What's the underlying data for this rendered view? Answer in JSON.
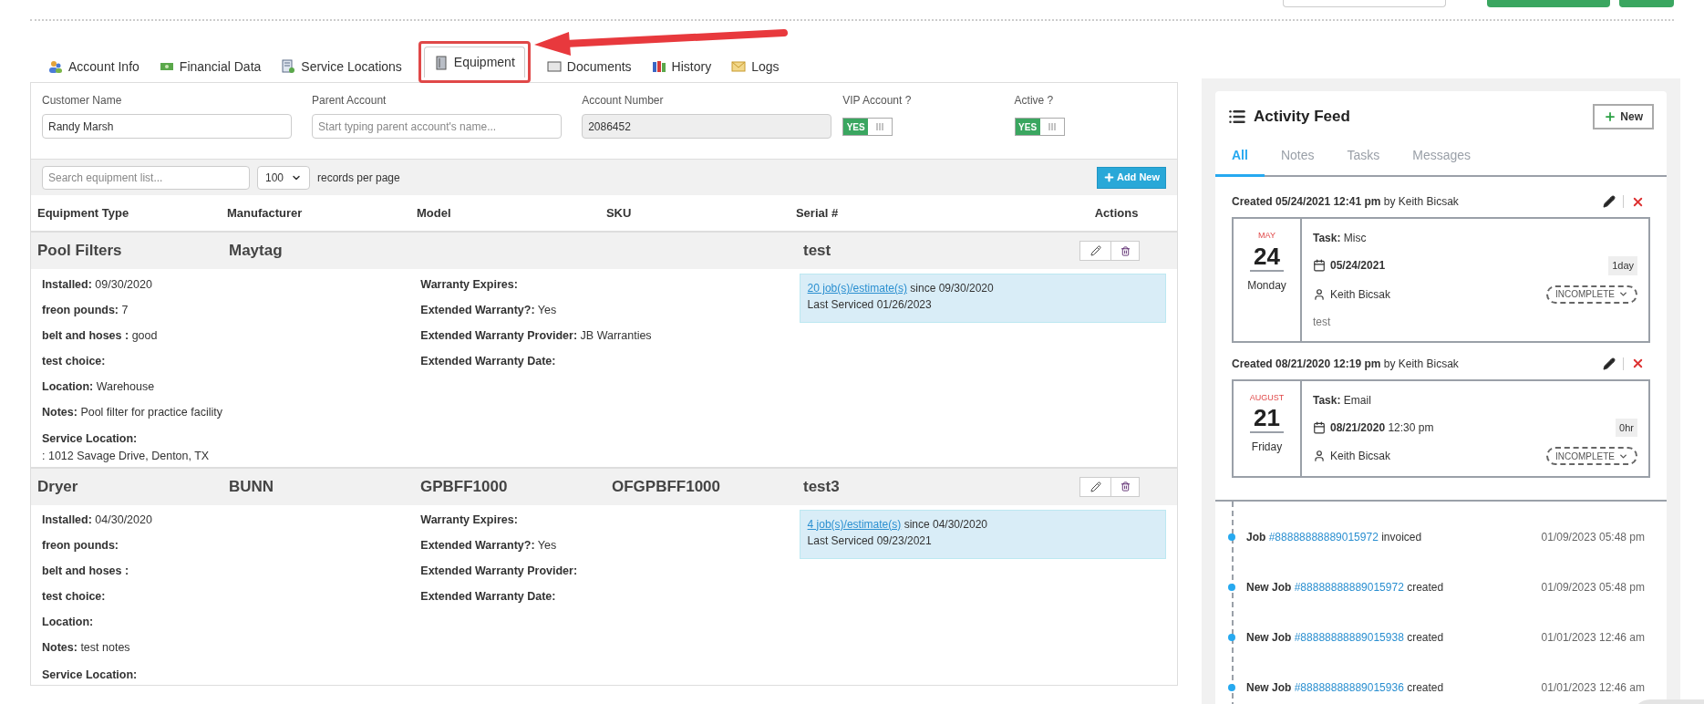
{
  "tabs": [
    {
      "label": "Account Info",
      "selected": false
    },
    {
      "label": "Financial Data",
      "selected": false
    },
    {
      "label": "Service Locations",
      "selected": false
    },
    {
      "label": "Equipment",
      "selected": true
    },
    {
      "label": "Documents",
      "selected": false
    },
    {
      "label": "History",
      "selected": false
    },
    {
      "label": "Logs",
      "selected": false
    }
  ],
  "form": {
    "fields": [
      {
        "label": "Customer Name",
        "value": "Randy Marsh",
        "disabled": false
      },
      {
        "label": "Parent Account",
        "placeholder": "Start typing parent account's name...",
        "disabled": false
      },
      {
        "label": "Account Number",
        "value": "2086452",
        "disabled": true
      }
    ],
    "toggles": [
      {
        "label": "VIP Account ?",
        "text": "YES",
        "on": true
      },
      {
        "label": "Active ?",
        "text": "YES",
        "on": true
      }
    ]
  },
  "toolbar": {
    "search_placeholder": "Search equipment list...",
    "page_size": "100",
    "page_size_label": "records per page",
    "add_button": "Add New"
  },
  "columns": [
    "Equipment Type",
    "Manufacturer",
    "Model",
    "SKU",
    "Serial #",
    "Actions"
  ],
  "equipment": [
    {
      "type": "Pool Filters",
      "manufacturer": "Maytag",
      "serial": "test",
      "details_left": [
        {
          "label": "Installed:",
          "value": "09/30/2020"
        },
        {
          "label": "freon pounds:",
          "value": "7"
        },
        {
          "label": "belt and hoses :",
          "value": "good"
        },
        {
          "label": "test choice:"
        },
        {
          "label": "Location:",
          "value": "Warehouse"
        },
        {
          "label": "Notes:",
          "value": "Pool filter for practice facility"
        }
      ],
      "service_location": {
        "label": "Service Location:",
        "value": ": 1012 Savage Drive, Denton, TX"
      },
      "details_right": [
        {
          "label": "Warranty Expires:"
        },
        {
          "label": "Extended Warranty?:",
          "value": "Yes"
        },
        {
          "label": "Extended Warranty Provider:",
          "value": "JB Warranties"
        },
        {
          "label": "Extended Warranty Date:"
        }
      ],
      "jobs": {
        "link": "20 job(s)/estimate(s)",
        "since": "since 09/30/2020",
        "last": "Last Serviced 01/26/2023"
      }
    },
    {
      "type": "Dryer",
      "manufacturer": "BUNN",
      "model": "GPBFF1000",
      "sku": "OFGPBFF1000",
      "serial": "test3",
      "details_left": [
        {
          "label": "Installed:",
          "value": "04/30/2020"
        },
        {
          "label": "freon pounds:"
        },
        {
          "label": "belt and hoses :"
        },
        {
          "label": "test choice:"
        },
        {
          "label": "Location:"
        },
        {
          "label": "Notes:",
          "value": "test notes"
        }
      ],
      "service_location": {
        "label": "Service Location:"
      },
      "details_right": [
        {
          "label": "Warranty Expires:"
        },
        {
          "label": "Extended Warranty?:",
          "value": "Yes"
        },
        {
          "label": "Extended Warranty Provider:"
        },
        {
          "label": "Extended Warranty Date:"
        }
      ],
      "jobs": {
        "link": "4 job(s)/estimate(s)",
        "since": "since 04/30/2020",
        "last": "Last Serviced 09/23/2021"
      }
    }
  ],
  "activity": {
    "title": "Activity Feed",
    "new_button": "New",
    "tabs": [
      {
        "label": "All",
        "selected": true
      },
      {
        "label": "Notes",
        "selected": false
      },
      {
        "label": "Tasks",
        "selected": false
      },
      {
        "label": "Messages",
        "selected": false
      }
    ],
    "tasks": [
      {
        "created": "**Created 05/24/2021 12:41 pm** by Keith Bicsak",
        "month": "MAY",
        "day": "24",
        "weekday": "Monday",
        "task": "**Task:** Misc",
        "date": "05/24/2021",
        "duration": "1day",
        "assignee": "Keith Bicsak",
        "status": "INCOMPLETE",
        "note": "test"
      },
      {
        "created": "**Created 08/21/2020 12:19 pm** by Keith Bicsak",
        "month": "AUGUST",
        "day": "21",
        "weekday": "Friday",
        "task": "**Task:** Email",
        "date": "08/21/2020",
        "time": "12:30 pm",
        "duration": "0hr",
        "assignee": "Keith Bicsak",
        "status": "INCOMPLETE"
      }
    ],
    "events": [
      {
        "subject": "Job",
        "ref": "#88888888889015972",
        "action": "invoiced",
        "time": "01/09/2023 05:48 pm"
      },
      {
        "subject": "New Job",
        "ref": "#88888888889015972",
        "action": "created",
        "time": "01/09/2023 05:48 pm"
      },
      {
        "subject": "New Job",
        "ref": "#88888888889015938",
        "action": "created",
        "time": "01/01/2023 12:46 am"
      },
      {
        "subject": "New Job",
        "ref": "#88888888889015936",
        "action": "created",
        "time": "01/01/2023 12:46 am"
      }
    ]
  }
}
